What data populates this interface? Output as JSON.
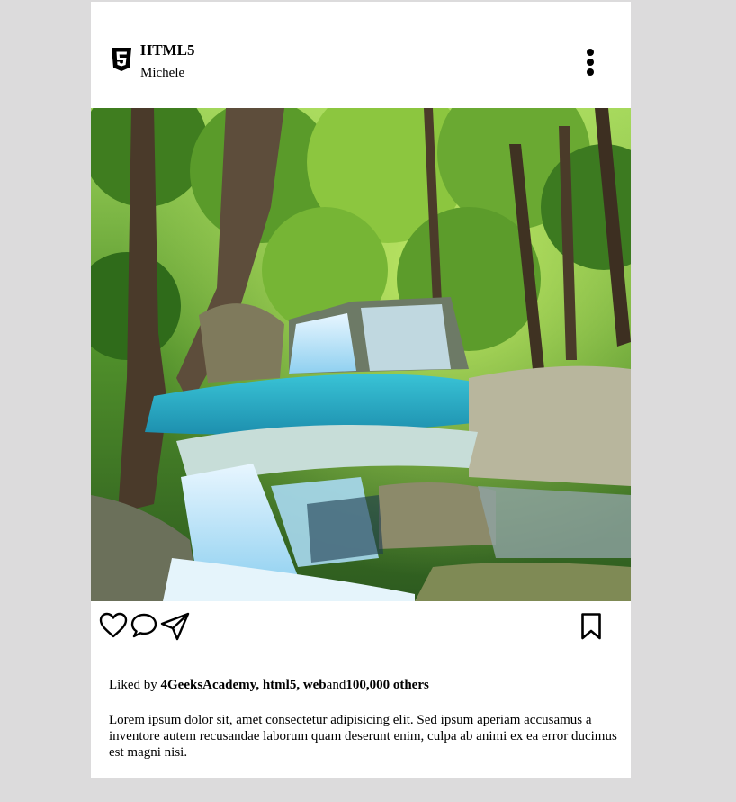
{
  "post": {
    "account_name": "HTML5",
    "user_name": "Michele",
    "logo_icon": "html5-logo-icon",
    "menu_icon": "more-vertical-icon",
    "image_description": "waterfall-forest-photo",
    "actions": {
      "like_icon": "heart-icon",
      "comment_icon": "comment-icon",
      "share_icon": "send-icon",
      "save_icon": "bookmark-icon"
    },
    "likes": {
      "prefix": "Liked by ",
      "names": "4GeeksAcademy, html5, web",
      "connector": "and",
      "count": "100,000 others"
    },
    "caption": "Lorem ipsum dolor sit, amet consectetur adipisicing elit. Sed ipsum aperiam accusamus a inventore autem recusandae laborum quam deserunt enim, culpa ab animi ex ea error ducimus est magni nisi."
  },
  "colors": {
    "page_background": "#dcdbdc",
    "card_background": "#ffffff",
    "text": "#000000"
  }
}
